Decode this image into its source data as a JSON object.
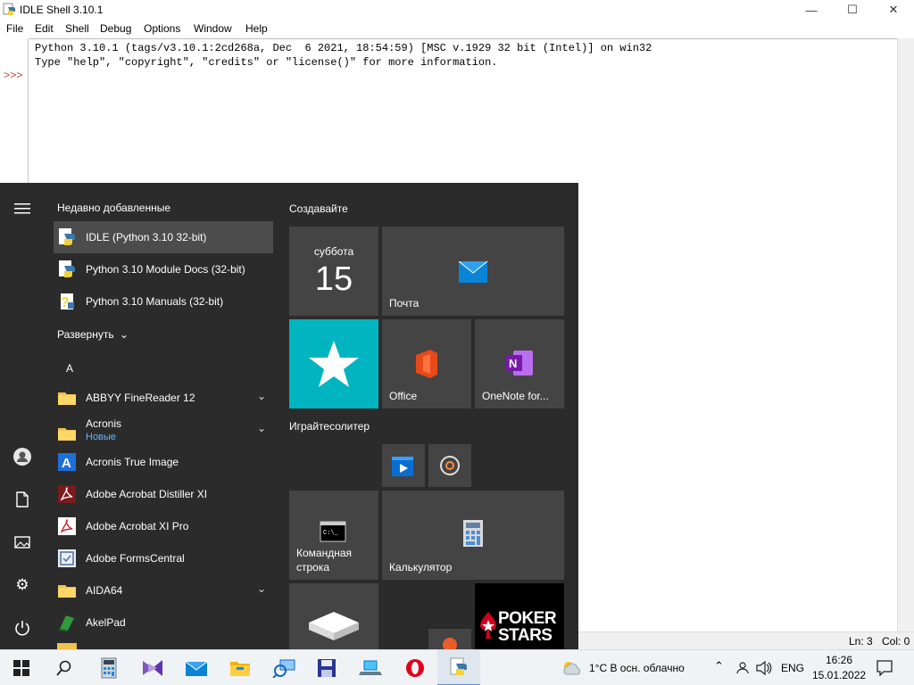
{
  "window": {
    "title": "IDLE Shell 3.10.1",
    "controls": {
      "minimize": "—",
      "maximize": "☐",
      "close": "✕"
    }
  },
  "menubar": [
    "File",
    "Edit",
    "Shell",
    "Debug",
    "Options",
    "Window",
    "Help"
  ],
  "shell": {
    "prompt": ">>>",
    "lines": [
      "Python 3.10.1 (tags/v3.10.1:2cd268a, Dec  6 2021, 18:54:59) [MSC v.1929 32 bit (Intel)] on win32",
      "Type \"help\", \"copyright\", \"credits\" or \"license()\" for more information."
    ]
  },
  "status": {
    "line": "Ln: 3",
    "col": "Col: 0"
  },
  "start_menu": {
    "recent_header": "Недавно добавленные",
    "recent": [
      {
        "label": "IDLE (Python 3.10 32-bit)",
        "icon": "python-idle-icon"
      },
      {
        "label": "Python 3.10 Module Docs (32-bit)",
        "icon": "python-docs-icon"
      },
      {
        "label": "Python 3.10 Manuals (32-bit)",
        "icon": "python-manuals-icon"
      }
    ],
    "expand_label": "Развернуть",
    "letter": "A",
    "apps": [
      {
        "label": "ABBYY FineReader 12",
        "icon": "folder-icon",
        "expandable": true
      },
      {
        "label": "Acronis",
        "sub": "Новые",
        "icon": "folder-icon",
        "expandable": true
      },
      {
        "label": "Acronis True Image",
        "icon": "acronis-icon"
      },
      {
        "label": "Adobe Acrobat Distiller XI",
        "icon": "acrobat-icon"
      },
      {
        "label": "Adobe Acrobat XI Pro",
        "icon": "acrobat-icon"
      },
      {
        "label": "Adobe FormsCentral",
        "icon": "formscentral-icon"
      },
      {
        "label": "AIDA64",
        "icon": "folder-icon",
        "expandable": true
      },
      {
        "label": "AkelPad",
        "icon": "akelpad-icon"
      }
    ],
    "groups": [
      "Создавайте",
      "Играйтесолитер"
    ],
    "tiles": {
      "calendar_day": "суббота",
      "calendar_date": "15",
      "mail": "Почта",
      "office": "Office",
      "onenote": "OneNote for...",
      "cmd": "Командная строка",
      "calc": "Калькулятор",
      "pokerstars": "POKER STARS"
    },
    "colors": {
      "teal": "#00b4c0",
      "tile": "#444444",
      "bg": "#2b2b2b"
    }
  },
  "taskbar": {
    "weather": "1°C  В осн. облачно",
    "lang": "ENG",
    "time": "16:26",
    "date": "15.01.2022"
  }
}
